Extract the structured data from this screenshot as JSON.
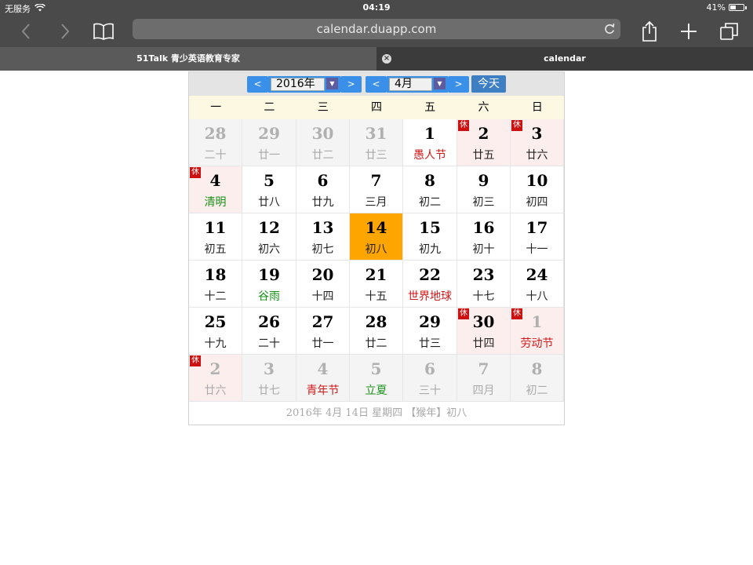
{
  "status": {
    "carrier": "无服务",
    "time": "04:19",
    "battery": "41%",
    "battery_level": 0.41
  },
  "browser": {
    "url": "calendar.duapp.com",
    "tabs": [
      {
        "title": "51Talk 青少英语教育专家"
      },
      {
        "title": "calendar"
      }
    ]
  },
  "calendar": {
    "year": "2016年",
    "month": "4月",
    "today_label": "今天",
    "prev": "<",
    "next": ">",
    "weekdays": [
      "一",
      "二",
      "三",
      "四",
      "五",
      "六",
      "日"
    ],
    "weeks": [
      [
        {
          "day": "28",
          "lunar": "二十",
          "other": true
        },
        {
          "day": "29",
          "lunar": "廿一",
          "other": true
        },
        {
          "day": "30",
          "lunar": "廿二",
          "other": true
        },
        {
          "day": "31",
          "lunar": "廿三",
          "other": true
        },
        {
          "day": "1",
          "lunar": "愚人节",
          "style": "red"
        },
        {
          "day": "2",
          "lunar": "廿五",
          "rest": true,
          "holiday": true
        },
        {
          "day": "3",
          "lunar": "廿六",
          "rest": true,
          "holiday": true
        }
      ],
      [
        {
          "day": "4",
          "lunar": "清明",
          "style": "green",
          "rest": true,
          "holiday": true
        },
        {
          "day": "5",
          "lunar": "廿八"
        },
        {
          "day": "6",
          "lunar": "廿九"
        },
        {
          "day": "7",
          "lunar": "三月"
        },
        {
          "day": "8",
          "lunar": "初二"
        },
        {
          "day": "9",
          "lunar": "初三"
        },
        {
          "day": "10",
          "lunar": "初四"
        }
      ],
      [
        {
          "day": "11",
          "lunar": "初五"
        },
        {
          "day": "12",
          "lunar": "初六"
        },
        {
          "day": "13",
          "lunar": "初七"
        },
        {
          "day": "14",
          "lunar": "初八",
          "today": true
        },
        {
          "day": "15",
          "lunar": "初九"
        },
        {
          "day": "16",
          "lunar": "初十"
        },
        {
          "day": "17",
          "lunar": "十一"
        }
      ],
      [
        {
          "day": "18",
          "lunar": "十二"
        },
        {
          "day": "19",
          "lunar": "谷雨",
          "style": "green"
        },
        {
          "day": "20",
          "lunar": "十四"
        },
        {
          "day": "21",
          "lunar": "十五"
        },
        {
          "day": "22",
          "lunar": "世界地球",
          "style": "red"
        },
        {
          "day": "23",
          "lunar": "十七"
        },
        {
          "day": "24",
          "lunar": "十八"
        }
      ],
      [
        {
          "day": "25",
          "lunar": "十九"
        },
        {
          "day": "26",
          "lunar": "二十"
        },
        {
          "day": "27",
          "lunar": "廿一"
        },
        {
          "day": "28",
          "lunar": "廿二"
        },
        {
          "day": "29",
          "lunar": "廿三"
        },
        {
          "day": "30",
          "lunar": "廿四",
          "rest": true,
          "holiday": true
        },
        {
          "day": "1",
          "lunar": "劳动节",
          "style": "red",
          "rest": true,
          "holiday": true,
          "other": true
        }
      ],
      [
        {
          "day": "2",
          "lunar": "廿六",
          "rest": true,
          "holiday": true,
          "other": true
        },
        {
          "day": "3",
          "lunar": "廿七",
          "other": true
        },
        {
          "day": "4",
          "lunar": "青年节",
          "style": "red",
          "other": true
        },
        {
          "day": "5",
          "lunar": "立夏",
          "style": "green",
          "other": true
        },
        {
          "day": "6",
          "lunar": "三十",
          "other": true
        },
        {
          "day": "7",
          "lunar": "四月",
          "other": true
        },
        {
          "day": "8",
          "lunar": "初二",
          "other": true
        }
      ]
    ],
    "rest_label": "休",
    "footer": "2016年 4月 14日 星期四 【猴年】初八"
  }
}
